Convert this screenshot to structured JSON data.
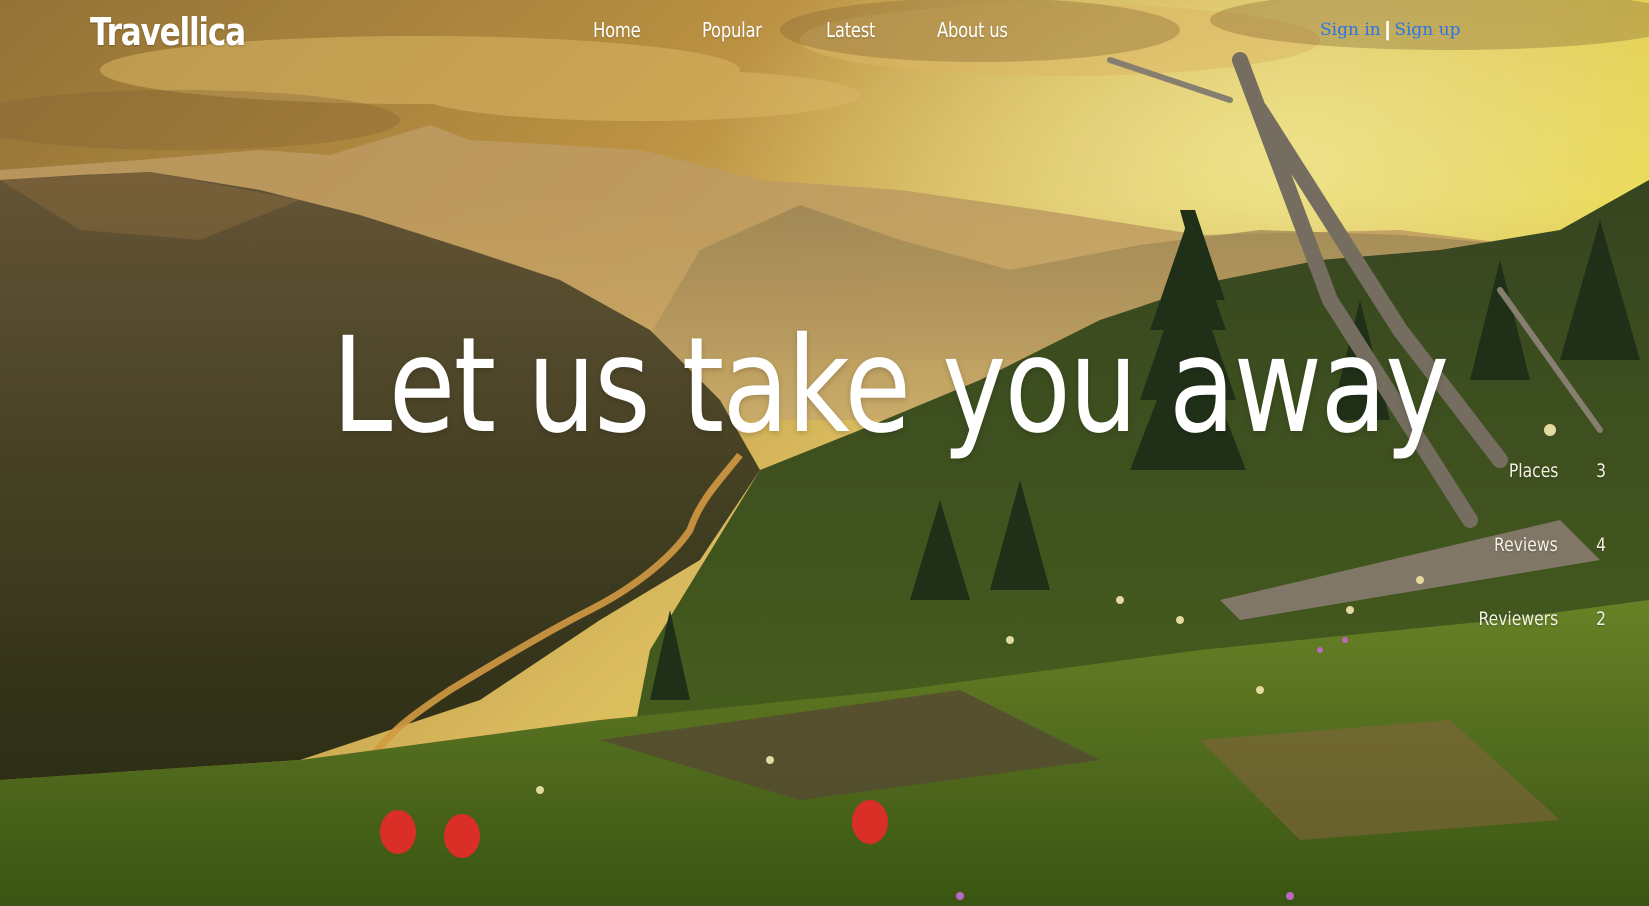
{
  "brand": "Travellica",
  "nav": {
    "home": "Home",
    "popular": "Popular",
    "latest": "Latest",
    "about": "About us"
  },
  "auth": {
    "sign_in": "Sign in",
    "separator": "|",
    "sign_up": "Sign up"
  },
  "hero": {
    "headline": "Let us take you away",
    "background": "mountain-valley-sunset-photo"
  },
  "stats": [
    {
      "label": "Places",
      "value": "3"
    },
    {
      "label": "Reviews",
      "value": "4"
    },
    {
      "label": "Reviewers",
      "value": "2"
    }
  ],
  "colors": {
    "link_blue": "#2b74e6",
    "text_white": "#ffffff",
    "sky_yellow": "#f6e23a"
  }
}
